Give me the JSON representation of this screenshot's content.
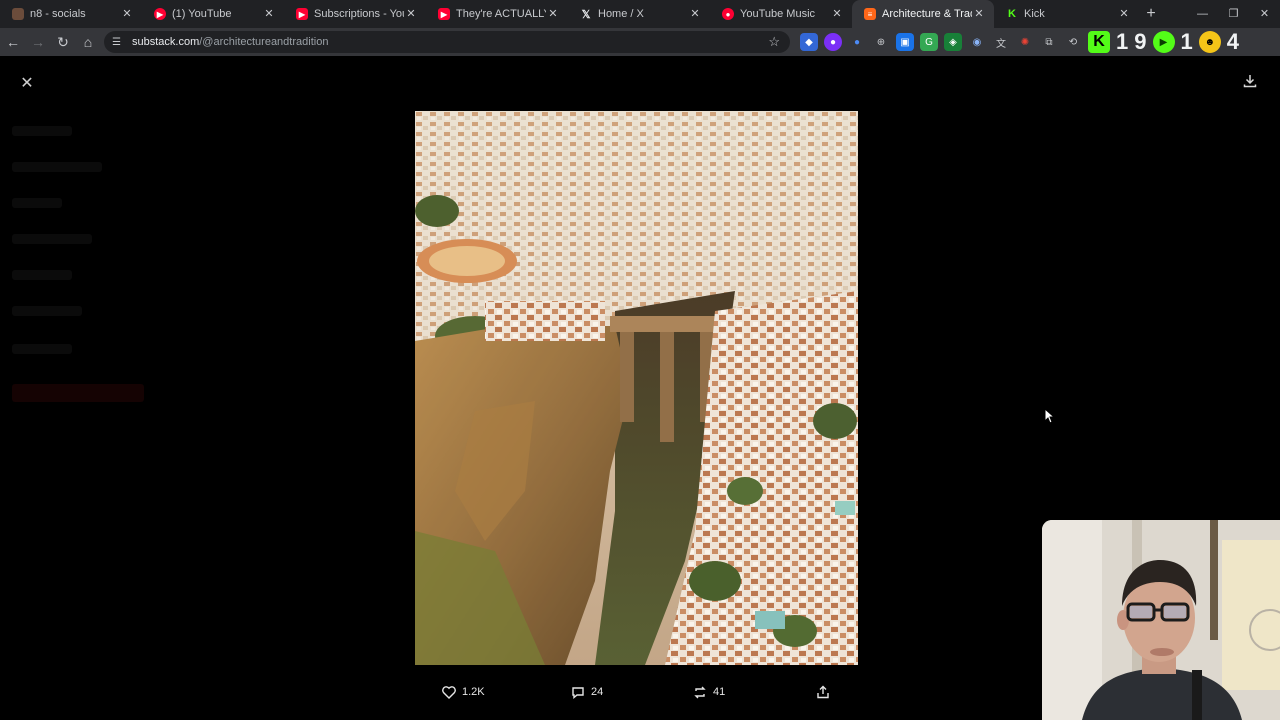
{
  "tabs": [
    {
      "title": "n8 - socials",
      "favicon": "n8-icon",
      "color": "#6b4c3b"
    },
    {
      "title": "(1) YouTube",
      "favicon": "youtube-icon",
      "color": "#ff0033"
    },
    {
      "title": "Subscriptions - YouTube",
      "favicon": "youtube-icon",
      "color": "#ff0033"
    },
    {
      "title": "They're ACTUALLY DOING",
      "favicon": "youtube-icon",
      "color": "#ff0033"
    },
    {
      "title": "Home / X",
      "favicon": "x-icon",
      "color": "#202124"
    },
    {
      "title": "YouTube Music",
      "favicon": "youtube-music-icon",
      "color": "#ff0033"
    },
    {
      "title": "Architecture & Tradition |",
      "favicon": "substack-icon",
      "color": "#ff6719",
      "active": true
    },
    {
      "title": "Kick",
      "favicon": "kick-icon",
      "color": "#53fc18"
    }
  ],
  "address": {
    "host": "substack.com",
    "path": "/@architectureandtradition"
  },
  "extensions": {
    "counter_a": "1",
    "counter_b": "9",
    "counter_c": "1",
    "counter_d": "4"
  },
  "post": {
    "likes": "1.2K",
    "comments": "24",
    "restacks": "41"
  },
  "colors": {
    "accent": "#ff6719",
    "background": "#000000"
  }
}
